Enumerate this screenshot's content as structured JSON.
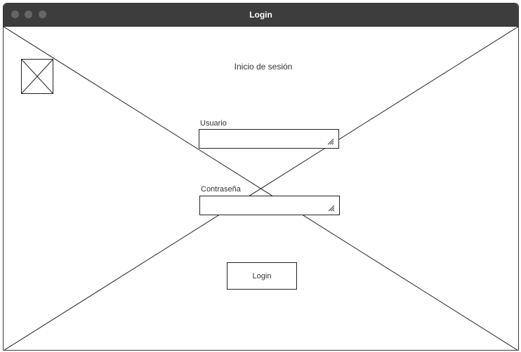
{
  "window": {
    "title": "Login"
  },
  "form": {
    "heading": "Inicio de sesión",
    "username_label": "Usuario",
    "password_label": "Contraseña",
    "login_button": "Login"
  },
  "colors": {
    "titlebar": "#3d3d3d",
    "title_text": "#ffffff",
    "wire": "#222222"
  }
}
